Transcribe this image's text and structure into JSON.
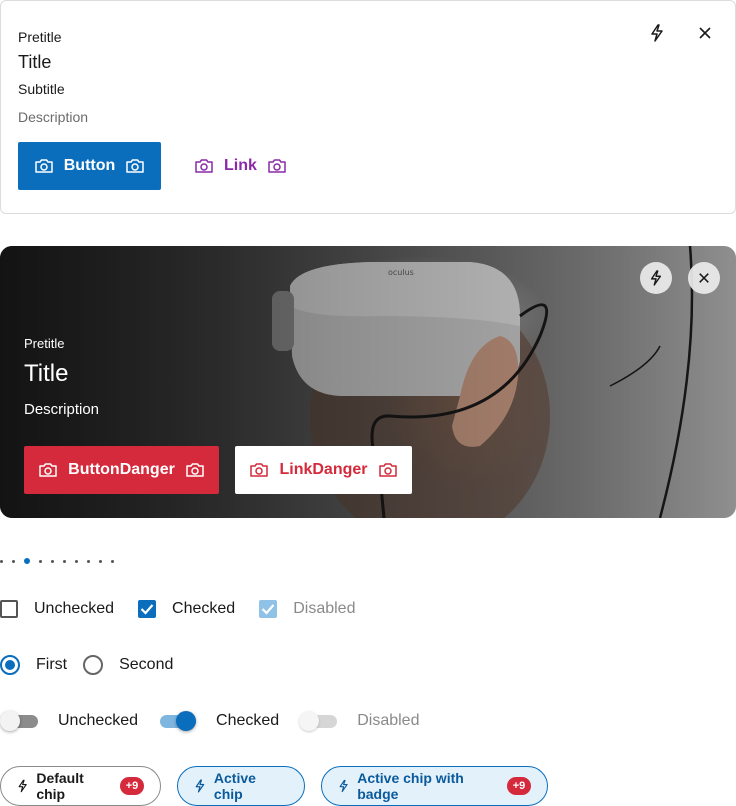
{
  "card1": {
    "pretitle": "Pretitle",
    "title": "Title",
    "subtitle": "Subtitle",
    "description": "Description",
    "primary_button_label": "Button",
    "link_label": "Link"
  },
  "card2": {
    "pretitle": "Pretitle",
    "title": "Title",
    "description": "Description",
    "danger_button_label": "ButtonDanger",
    "danger_link_label": "LinkDanger",
    "image_brand_text": "oculus"
  },
  "pagination": {
    "count": 10,
    "active_index": 2
  },
  "checkboxes": [
    {
      "label": "Unchecked",
      "checked": false,
      "disabled": false
    },
    {
      "label": "Checked",
      "checked": true,
      "disabled": false
    },
    {
      "label": "Disabled",
      "checked": true,
      "disabled": true
    }
  ],
  "radios": [
    {
      "label": "First",
      "selected": true
    },
    {
      "label": "Second",
      "selected": false
    }
  ],
  "toggles": [
    {
      "label": "Unchecked",
      "on": false,
      "disabled": false
    },
    {
      "label": "Checked",
      "on": true,
      "disabled": false
    },
    {
      "label": "Disabled",
      "on": false,
      "disabled": true
    }
  ],
  "chips": [
    {
      "label": "Default chip",
      "badge": "+9",
      "variant": "default"
    },
    {
      "label": "Active chip",
      "badge": "",
      "variant": "active"
    },
    {
      "label": "Active chip with badge",
      "badge": "+9",
      "variant": "active"
    }
  ],
  "colors": {
    "primary": "#0a6ebd",
    "danger": "#d42a3c",
    "link_purple": "#8a2aa8"
  },
  "icons": {
    "card_action": "lightning-icon",
    "card_close": "close-icon",
    "button_icon": "camera-icon",
    "chip_icon": "lightning-icon"
  }
}
